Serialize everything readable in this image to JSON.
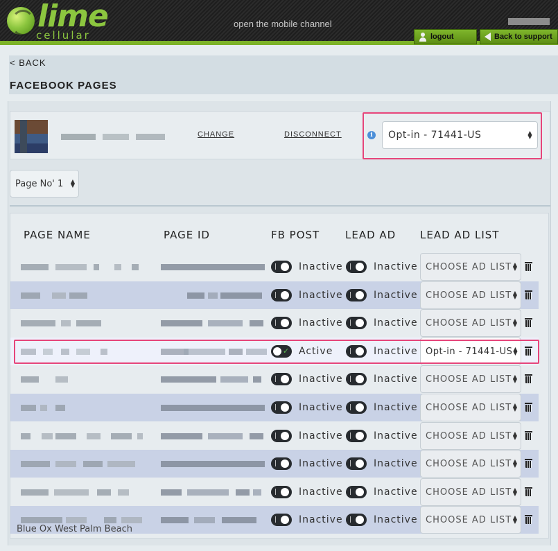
{
  "header": {
    "logo_word": "lime",
    "logo_sub": "cellular",
    "tagline": "open the mobile channel",
    "logout_label": "logout",
    "support_label": "Back to support"
  },
  "nav": {
    "back_label": "< BACK"
  },
  "page_title": "FACEBOOK PAGES",
  "connected_page": {
    "change_label": "CHANGE",
    "disconnect_label": "DISCONNECT",
    "info_glyph": "i",
    "default_ad_list": "Opt-in - 71441-US"
  },
  "page_selector": {
    "value": "Page No' 1"
  },
  "table": {
    "headers": {
      "page_name": "PAGE NAME",
      "page_id": "PAGE ID",
      "fb_post": "FB POST",
      "lead_ad": "LEAD AD",
      "lead_ad_list": "LEAD AD LIST"
    },
    "rows": [
      {
        "fb_post": "Inactive",
        "lead_ad": "Inactive",
        "ad_list": "CHOOSE AD LIST"
      },
      {
        "fb_post": "Inactive",
        "lead_ad": "Inactive",
        "ad_list": "CHOOSE AD LIST"
      },
      {
        "fb_post": "Inactive",
        "lead_ad": "Inactive",
        "ad_list": "CHOOSE AD LIST"
      },
      {
        "fb_post": "Active",
        "lead_ad": "Inactive",
        "ad_list": "Opt-in - 71441-US"
      },
      {
        "fb_post": "Inactive",
        "lead_ad": "Inactive",
        "ad_list": "CHOOSE AD LIST"
      },
      {
        "fb_post": "Inactive",
        "lead_ad": "Inactive",
        "ad_list": "CHOOSE AD LIST"
      },
      {
        "fb_post": "Inactive",
        "lead_ad": "Inactive",
        "ad_list": "CHOOSE AD LIST"
      },
      {
        "fb_post": "Inactive",
        "lead_ad": "Inactive",
        "ad_list": "CHOOSE AD LIST"
      },
      {
        "fb_post": "Inactive",
        "lead_ad": "Inactive",
        "ad_list": "CHOOSE AD LIST"
      },
      {
        "fb_post": "Inactive",
        "lead_ad": "Inactive",
        "ad_list": "CHOOSE AD LIST"
      }
    ],
    "trailing_text": "Blue Ox West Palm Beach"
  },
  "colors": {
    "brand_green": "#7cb228",
    "highlight_pink": "#e6457a",
    "alt_row": "#c9d2e6",
    "toggle_dark": "#272b2f"
  }
}
